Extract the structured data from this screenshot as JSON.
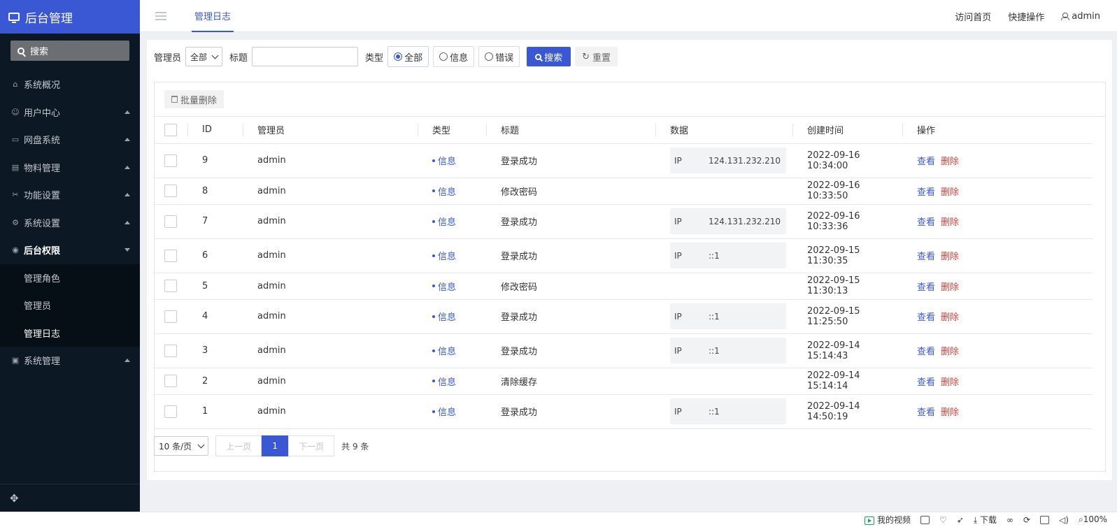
{
  "sidebar": {
    "brand": "后台管理",
    "search_label": "搜索",
    "items": [
      {
        "label": "系统概况",
        "icon": "home-icon",
        "glyph": "⌂",
        "caret": false
      },
      {
        "label": "用户中心",
        "icon": "users-icon",
        "glyph": "☺",
        "caret": true
      },
      {
        "label": "网盘系统",
        "icon": "folder-icon",
        "glyph": "▭",
        "caret": true
      },
      {
        "label": "物料管理",
        "icon": "document-icon",
        "glyph": "▤",
        "caret": true
      },
      {
        "label": "功能设置",
        "icon": "tools-icon",
        "glyph": "✂",
        "caret": true
      },
      {
        "label": "系统设置",
        "icon": "gear-icon",
        "glyph": "⚙",
        "caret": true
      },
      {
        "label": "后台权限",
        "icon": "user-circle-icon",
        "glyph": "◉",
        "caret": true,
        "open": true,
        "active": true
      },
      {
        "label": "系统管理",
        "icon": "monitor-icon",
        "glyph": "▣",
        "caret": true
      }
    ],
    "submenu": [
      "管理角色",
      "管理员",
      "管理日志"
    ],
    "submenu_current": "管理日志",
    "footer_icon": "move-icon"
  },
  "header": {
    "tab": "管理日志",
    "links": [
      "访问首页",
      "快捷操作"
    ],
    "user": "admin"
  },
  "filters": {
    "admin_label": "管理员",
    "admin_value": "全部",
    "title_label": "标题",
    "title_value": "",
    "type_label": "类型",
    "type_options": [
      "全部",
      "信息",
      "错误"
    ],
    "type_selected": "全部",
    "search_btn": "搜索",
    "reset_btn": "重置"
  },
  "toolbar": {
    "batch_delete": "批量删除"
  },
  "table": {
    "columns": [
      "ID",
      "管理员",
      "类型",
      "标题",
      "数据",
      "创建时间",
      "操作"
    ],
    "rows": [
      {
        "id": "9",
        "admin": "admin",
        "type": "信息",
        "title": "登录成功",
        "ip_key": "IP",
        "ip": "124.131.232.210",
        "time": "2022-09-16 10:34:00"
      },
      {
        "id": "8",
        "admin": "admin",
        "type": "信息",
        "title": "修改密码",
        "ip_key": "",
        "ip": "",
        "time": "2022-09-16 10:33:50"
      },
      {
        "id": "7",
        "admin": "admin",
        "type": "信息",
        "title": "登录成功",
        "ip_key": "IP",
        "ip": "124.131.232.210",
        "time": "2022-09-16 10:33:36"
      },
      {
        "id": "6",
        "admin": "admin",
        "type": "信息",
        "title": "登录成功",
        "ip_key": "IP",
        "ip": "::1",
        "time": "2022-09-15 11:30:35"
      },
      {
        "id": "5",
        "admin": "admin",
        "type": "信息",
        "title": "修改密码",
        "ip_key": "",
        "ip": "",
        "time": "2022-09-15 11:30:13"
      },
      {
        "id": "4",
        "admin": "admin",
        "type": "信息",
        "title": "登录成功",
        "ip_key": "IP",
        "ip": "::1",
        "time": "2022-09-15 11:25:50"
      },
      {
        "id": "3",
        "admin": "admin",
        "type": "信息",
        "title": "登录成功",
        "ip_key": "IP",
        "ip": "::1",
        "time": "2022-09-14 15:14:43"
      },
      {
        "id": "2",
        "admin": "admin",
        "type": "信息",
        "title": "清除缓存",
        "ip_key": "",
        "ip": "",
        "time": "2022-09-14 15:14:14"
      },
      {
        "id": "1",
        "admin": "admin",
        "type": "信息",
        "title": "登录成功",
        "ip_key": "IP",
        "ip": "::1",
        "time": "2022-09-14 14:50:19"
      }
    ],
    "view_label": "查看",
    "delete_label": "删除"
  },
  "pager": {
    "page_size": "10 条/页",
    "prev": "上一页",
    "current": "1",
    "next": "下一页",
    "total": "共 9 条"
  },
  "statusbar": {
    "video": "我的视频",
    "download": "下载",
    "zoom": "100%"
  },
  "colors": {
    "accent": "#3a58d4",
    "sidebar_bg": "#0c1824",
    "danger": "#e0433a"
  }
}
